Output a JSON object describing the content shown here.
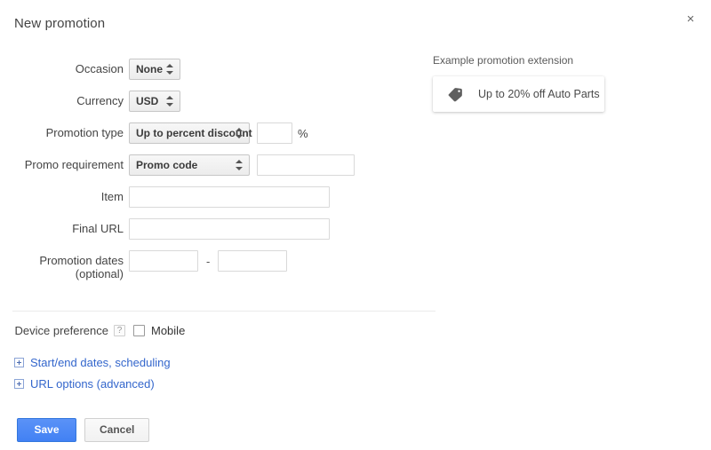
{
  "dialog": {
    "title": "New promotion",
    "close_label": "×"
  },
  "form": {
    "rows": [
      {
        "label": "Occasion",
        "control": "select",
        "value": "None"
      },
      {
        "label": "Currency",
        "control": "select",
        "value": "USD"
      },
      {
        "label": "Promotion type",
        "control": "select",
        "value": "Up to percent discount"
      },
      {
        "label": "Promo requirement",
        "control": "select",
        "value": "Promo code"
      },
      {
        "label": "Item",
        "control": "text",
        "value": ""
      },
      {
        "label": "Final URL",
        "control": "text",
        "value": ""
      },
      {
        "label": "Promotion dates",
        "label2": "(optional)",
        "control": "date-range",
        "value": ""
      }
    ],
    "occasion_label": "Occasion",
    "occasion_value": "None",
    "currency_label": "Currency",
    "currency_value": "USD",
    "promotion_type_label": "Promotion type",
    "promotion_type_value": "Up to percent discount",
    "percent_value": "",
    "percent_placeholder": "",
    "percent_sign": "%",
    "promo_requirement_label": "Promo requirement",
    "promo_requirement_value": "Promo code",
    "promo_code_value": "",
    "item_label": "Item",
    "item_value": "",
    "final_url_label": "Final URL",
    "final_url_value": "",
    "promotion_dates_label": "Promotion dates",
    "promotion_dates_label2": "(optional)",
    "date_start_value": "",
    "date_end_value": "",
    "date_separator": "-"
  },
  "device": {
    "label": "Device preference",
    "help_glyph": "?",
    "checkbox_label": "Mobile",
    "checked": false
  },
  "expanders": [
    {
      "label": "Start/end dates, scheduling",
      "icon": "plus-box-icon"
    },
    {
      "label": "URL options (advanced)",
      "icon": "plus-box-icon"
    }
  ],
  "buttons": {
    "save_label": "Save",
    "cancel_label": "Cancel"
  },
  "example": {
    "caption": "Example promotion extension",
    "icon": "tag-icon",
    "text": "Up to 20% off Auto Parts"
  },
  "colors": {
    "primary_blue": "#4285f4",
    "link_blue": "#3366cc",
    "text": "#444444",
    "select_bg": "#f1f1f1",
    "border": "#d9d9d9",
    "tag_icon": "#5f5f5f"
  }
}
